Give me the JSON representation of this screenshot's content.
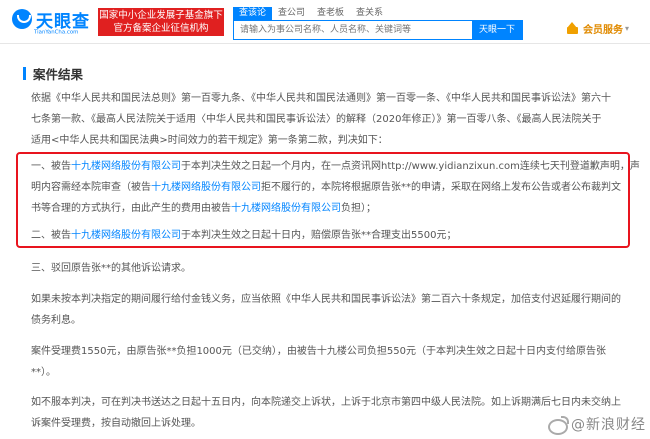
{
  "header": {
    "logo_name": "天眼查",
    "logo_domain": "TianYanCha.com",
    "slogan_line1": "国家中小企业发展子基金旗下",
    "slogan_line2": "官方备案企业征信机构",
    "tabs": [
      "查该论",
      "查公司",
      "查老板",
      "查关系"
    ],
    "search_placeholder": "请输入为事公司名称、人员名称、关键词等",
    "search_button": "天眼一下",
    "vip_label": "会员服务",
    "vip_caret": "▾"
  },
  "section": {
    "title": "案件结果"
  },
  "intro": {
    "line1": "依据《中华人民共和国民法总则》第一百零九条、《中华人民共和国民法通则》第一百零一条、《中华人民共和国民事诉讼法》第六十",
    "line2": "七条第一款、《最高人民法院关于适用〈中华人民共和国民事诉讼法〉的解释（2020年修正）》第一百零八条、《最高人民法院关于",
    "line3": "适用<中华人民共和国民法典>时间效力的若干规定》第一条第二款，判决如下："
  },
  "judgment1": {
    "line1_a": "一、被告",
    "line1_company": "十九楼网络股份有限公司",
    "line1_b": "于本判决生效之日起一个月内，在一点资讯网http://www.yidianzixun.com连续七天刊登道歉声明，声",
    "line2_a": "明内容需经本院审查（被告",
    "line2_company": "十九楼网络股份有限公司",
    "line2_b": "拒不履行的，本院将根据原告张**的申请，采取在网络上发布公告或者公布裁判文",
    "line3_a": "书等合理的方式执行，由此产生的费用由被告",
    "line3_company": "十九楼网络股份有限公司",
    "line3_b": "负担）；"
  },
  "judgment2": {
    "line1_a": "二、被告",
    "line1_company": "十九楼网络股份有限公司",
    "line1_b": "于本判决生效之日起十日内，赔偿原告张**合理支出5500元；"
  },
  "judgment3": {
    "line1": "三、驳回原告张**的其他诉讼请求。"
  },
  "interest": {
    "line1": "如果未按本判决指定的期间履行给付金钱义务，应当依照《中华人民共和国民事诉讼法》第二百六十条规定，加倍支付迟延履行期间的",
    "line2": "债务利息。"
  },
  "fee": {
    "line1": "案件受理费1550元，由原告张**负担1000元（已交纳），由被告十九楼公司负担550元（于本判决生效之日起十日内支付给原告张",
    "line2": "**）。"
  },
  "appeal": {
    "line1": "如不服本判决，可在判决书送达之日起十五日内，向本院递交上诉状，上诉于北京市第四中级人民法院。如上诉期满后七日内未交纳上",
    "line2": "诉案件受理费，按自动撤回上诉处理。"
  },
  "watermark": {
    "text": "@新浪财经"
  },
  "colors": {
    "accent": "#0084ff",
    "highlight_box": "#e8141e",
    "slogan_bg": "#e02020",
    "vip": "#e08a00"
  }
}
